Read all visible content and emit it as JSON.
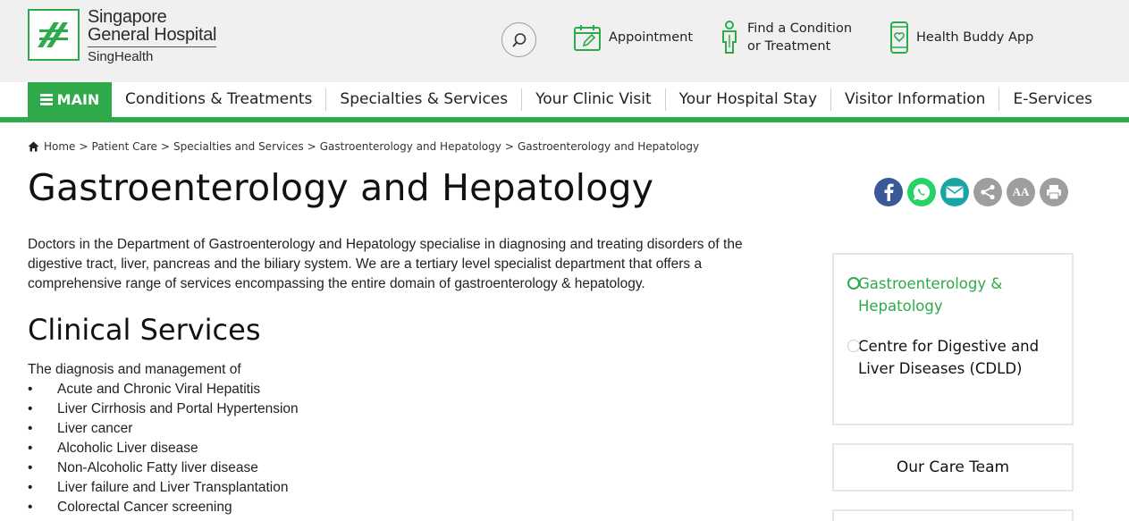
{
  "header": {
    "logo": {
      "line1": "Singapore",
      "line2": "General Hospital",
      "line3": "SingHealth"
    },
    "quick_links": [
      {
        "label": "Appointment"
      },
      {
        "label_line1": "Find a Condition",
        "label_line2": "or Treatment"
      },
      {
        "label": "Health Buddy App"
      }
    ]
  },
  "nav": {
    "main_label": "MAIN",
    "items": [
      "Conditions & Treatments",
      "Specialties & Services",
      "Your Clinic Visit",
      "Your Hospital Stay",
      "Visitor Information",
      "E-Services"
    ]
  },
  "breadcrumb": [
    "Home",
    "Patient Care",
    "Specialties and Services",
    "Gastroenterology and Hepatology",
    "Gastroenterology and Hepatology"
  ],
  "page": {
    "title": "Gastroenterology and Hepatology",
    "intro": "Doctors in the Department of Gastroenterology and Hepatology specialise in diagnosing and treating disorders of the digestive tract, liver, pancreas and the biliary system. We are a tertiary level specialist department that offers a comprehensive range of services encompassing the entire domain of gastroenterology & hepatology.",
    "section_heading": "Clinical Services",
    "diagnosis_lead": "The diagnosis and management of",
    "services": [
      "Acute and Chronic Viral Hepatitis",
      "Liver Cirrhosis and Portal Hypertension",
      "Liver cancer",
      "Alcoholic Liver disease",
      "Non-Alcoholic Fatty liver disease",
      "Liver failure and Liver Transplantation",
      "Colorectal Cancer screening"
    ]
  },
  "share": {
    "icons": [
      "facebook-icon",
      "whatsapp-icon",
      "email-icon",
      "share-icon",
      "font-size-icon",
      "print-icon"
    ],
    "font_size_label": "AA"
  },
  "sidebar": {
    "active_item": "Gastroenterology & Hepatology",
    "other_item": "Centre for Digestive and Liver Diseases (CDLD)",
    "care_team_label": "Our Care Team"
  },
  "colors": {
    "brand_green": "#2eaa4a",
    "facebook": "#3b5998",
    "whatsapp": "#25d366",
    "email": "#1aa5a5",
    "grey_icon": "#9e9e9e"
  }
}
